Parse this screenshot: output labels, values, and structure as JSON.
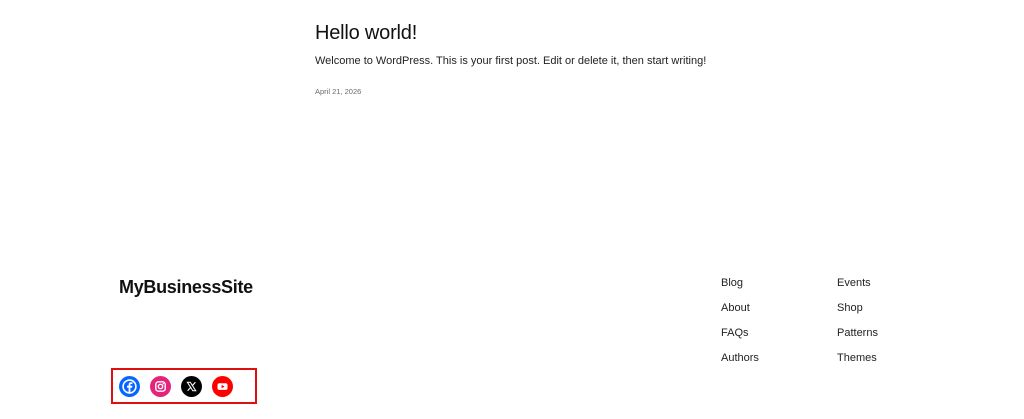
{
  "post": {
    "title": "Hello world!",
    "excerpt": "Welcome to WordPress. This is your first post. Edit or delete it, then start writing!",
    "date": "April 21, 2026"
  },
  "footer": {
    "site_title": "MyBusinessSite",
    "nav_col1": [
      "Blog",
      "About",
      "FAQs",
      "Authors"
    ],
    "nav_col2": [
      "Events",
      "Shop",
      "Patterns",
      "Themes"
    ],
    "social": [
      {
        "name": "facebook-icon",
        "color": "#0866ff"
      },
      {
        "name": "instagram-icon",
        "color": "#e4237a"
      },
      {
        "name": "x-icon",
        "color": "#000000"
      },
      {
        "name": "youtube-icon",
        "color": "#ff0000"
      }
    ],
    "highlight_color": "#e01010"
  }
}
